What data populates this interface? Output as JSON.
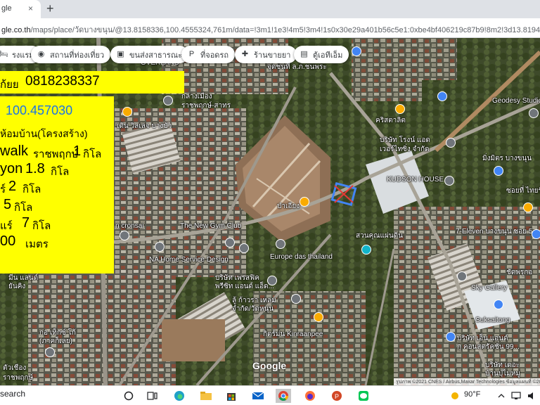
{
  "browser": {
    "tab_title": "gle",
    "tab_close": "×",
    "new_tab": "+",
    "url_host": "gle.co.th",
    "url_path": "/maps/place/วัดบางขนุน/@13.8158336,100.4555324,761m/data=!3m1!1e3!4m5!3m4!1s0x30e29a401b56c5e1:0xbe4bf406219c87b9!8m2!3d13.8194559!4d100.45"
  },
  "chips": [
    {
      "icon": "bed-icon",
      "glyph": "🛏",
      "label": "รงแรม"
    },
    {
      "icon": "camera-icon",
      "glyph": "◉",
      "label": "สถานที่ท่องเที่ยว"
    },
    {
      "icon": "bus-icon",
      "glyph": "▣",
      "label": "ขนส่งสาธารณะ"
    },
    {
      "icon": "parking-icon",
      "glyph": "P",
      "label": "ที่จอดรถ"
    },
    {
      "icon": "pharmacy-icon",
      "glyph": "✚",
      "label": "ร้านขายยา"
    },
    {
      "icon": "atm-icon",
      "glyph": "▤",
      "label": "ตู้เอทีเอ็ม"
    }
  ],
  "overlay": {
    "top_left": "ก้ยย",
    "phone": "0818238337",
    "coord": "100.457030",
    "line1": "ห้อมบ้าน(โครงสร้าง)",
    "line2_a": "walk",
    "line2_b": "ราชพฤกษ์",
    "line2_c": "1",
    "line2_d": "กิโล",
    "line3_a": "yon",
    "line3_b": "1.8",
    "line3_c": "กิโล",
    "line4_a": "ร์",
    "line4_b": "2",
    "line4_c": "กิโล",
    "line5_a": "5",
    "line5_b": "กิโล",
    "line6_a": "แร์",
    "line6_b": "7",
    "line6_c": "กิโล",
    "line7_a": "00",
    "line7_b": "เมตร"
  },
  "map_labels": {
    "overland": "OVERLAND",
    "l1": "จุดชนที่ ล.ภ.ชนพระ",
    "l2": "กลางเมือง",
    "l3": "ราชพฤกษ์-สาทร",
    "l4": "เดิน วิลเลจ บางบัว",
    "l5": "คริสตาลิต",
    "l6": "บริษัท โรงน์ แอด",
    "l7": "เวอร์ไทซิ่ง จำกัด",
    "l8": "KUDSON HOUSE",
    "l9": "ป่าเอียง",
    "l10": "The New Gym Club",
    "l11": "Europe das thailand",
    "l12": "สวนคุณแผ่นดิน",
    "l13": "NA Home Service Design",
    "l14": "บริษัท เพรสฟิค",
    "l15": "พรีซิท แอนด์ แอ็ด...",
    "l16": "ลู้ ก้าวรา เหลม",
    "l17": "จำกัด/วัดหนุน",
    "l18": "กิตร์ม่น Kinraanpee",
    "l19": "7-Eleven บางขนุน ซอย 5",
    "l20": "Sky Gallery",
    "l21": "Suksaitong",
    "l22": "Geodesy Studio",
    "l23": "มิ่งมิตร บางขนุน",
    "l24": "ซอยที่ ไทยรัช",
    "l25": "ชัดพรุกอ",
    "l26": "บริษัท เอ็น แอนด์",
    "l27": "กุ คอนสตรัคชั่น 99...",
    "l28": "บริษัท เดอะ",
    "l29": "บ้านปุ่ไม่หมู",
    "l30": "กอ เท็กซ์ โก้",
    "l31": "(ภาคก็เลย)",
    "l32": "ตัวเชือง",
    "l33": "ราชพฤกษ์",
    "l34": "มีน แลนด์",
    "l35": "ยันคิง",
    "l36": "n cronsai"
  },
  "map_footer": {
    "logo": "Google",
    "attribution": "รูปภาพ ©2021 CNES / Airbus,Maxar Technologies ข้อมูลแผนที่ ©2021   ไทย   ข้อกำหนด"
  },
  "taskbar": {
    "search": "search",
    "weather": "90°F"
  }
}
